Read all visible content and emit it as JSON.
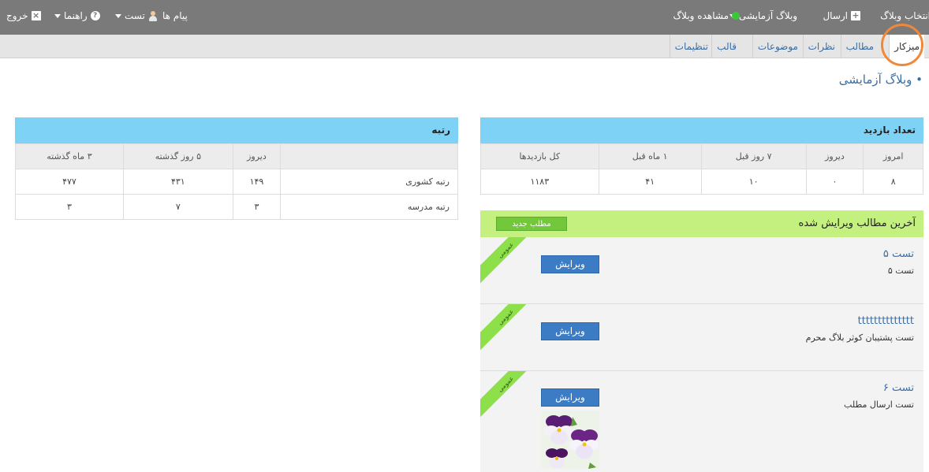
{
  "topbar": {
    "choose_blog": "انتخاب وبلاگ",
    "send": "ارسال",
    "blog_menu": "وبلاگ آزمایشی",
    "view_blog": "مشاهده وبلاگ",
    "messages": "پیام ها",
    "user": "تست",
    "help": "راهنما",
    "logout": "خروج"
  },
  "nav": {
    "tabs": [
      {
        "label": "میزکار"
      },
      {
        "label": "مطالب"
      },
      {
        "label": "نظرات"
      },
      {
        "label": "موضوعات"
      },
      {
        "label": "قالب"
      },
      {
        "label": "تنظیمات"
      }
    ]
  },
  "page": {
    "blog_title": "• وبلاگ آزمایشی"
  },
  "visits": {
    "title": "تعداد بازدید",
    "headers": [
      "امروز",
      "دیروز",
      "۷ روز قبل",
      "۱ ماه قبل",
      "کل بازدیدها"
    ],
    "values": [
      "۸",
      "۰",
      "۱۰",
      "۴۱",
      "۱۱۸۳"
    ]
  },
  "rank": {
    "title": "رتبه",
    "headers": [
      "",
      "دیروز",
      "۵ روز گذشته",
      "۳ ماه گذشته"
    ],
    "rows": [
      {
        "label": "رتبه کشوری",
        "values": [
          "۱۴۹",
          "۴۳۱",
          "۴۷۷"
        ]
      },
      {
        "label": "رتبه مدرسه",
        "values": [
          "۳",
          "۷",
          "۳"
        ]
      }
    ]
  },
  "latest": {
    "title": "آخرین مطالب ویرایش شده",
    "new_post": "مطلب جدید",
    "ribbon": "عمومی",
    "edit": "ویرایش",
    "posts": [
      {
        "title": "تست ۵",
        "summary": "تست ۵"
      },
      {
        "title": "tttttttttttttt",
        "summary": "تست پشتیبان کوثر بلاگ محرم"
      },
      {
        "title": "تست ۶",
        "summary": "تست ارسال مطلب"
      }
    ]
  },
  "colors": {
    "topbar": "#7a7a7a",
    "panel_header": "#7dd2f6",
    "latest_header": "#c3f07e",
    "edit_button": "#3b7cc4",
    "ribbon": "#8ee04a",
    "focus_ring": "#f0883a"
  }
}
